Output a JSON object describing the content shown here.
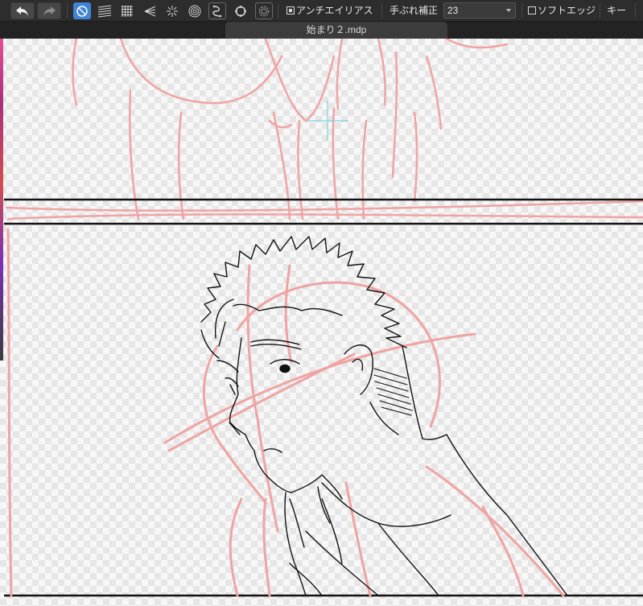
{
  "toolbar": {
    "undo_icon": "undo-arrow-icon",
    "redo_icon": "redo-arrow-icon",
    "tools": [
      {
        "icon": "no-ruler-icon",
        "active": true
      },
      {
        "icon": "parallel-lines-ruler-icon",
        "active": false
      },
      {
        "icon": "grid-ruler-icon",
        "active": false
      },
      {
        "icon": "perspective-ruler-icon",
        "active": false
      },
      {
        "icon": "radial-ruler-icon",
        "active": false
      },
      {
        "icon": "concentric-circle-ruler-icon",
        "active": false
      },
      {
        "icon": "curve-ruler-icon",
        "active": false
      },
      {
        "icon": "symmetry-ruler-icon",
        "active": false
      },
      {
        "icon": "ruler-settings-gear-icon",
        "active": false
      }
    ],
    "antialias_label": "アンチエイリアス",
    "antialias_checked": true,
    "stabilizer_label": "手ぶれ補正",
    "stabilizer_value": "23",
    "soft_edge_label": "ソフトエッジ",
    "soft_edge_checked": false,
    "key_label": "キー"
  },
  "tab": {
    "title": "始まり２.mdp"
  },
  "colors": {
    "accent": "#3f84d6",
    "sketch_red": "#f0a3a3",
    "line_black": "#111111",
    "cursor_cyan": "#7fd3e0"
  }
}
